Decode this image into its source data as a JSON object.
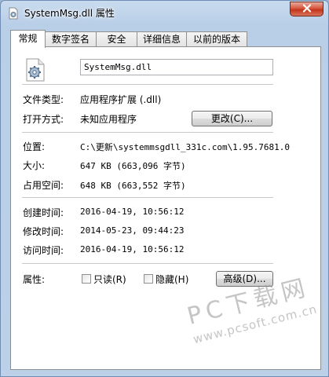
{
  "window": {
    "title": "SystemMsg.dll 属性"
  },
  "tabs": [
    {
      "label": "常规",
      "active": true
    },
    {
      "label": "数字签名",
      "active": false
    },
    {
      "label": "安全",
      "active": false
    },
    {
      "label": "详细信息",
      "active": false
    },
    {
      "label": "以前的版本",
      "active": false
    }
  ],
  "general": {
    "file_name": "SystemMsg.dll",
    "file_type_label": "文件类型:",
    "file_type_value": "应用程序扩展 (.dll)",
    "open_with_label": "打开方式:",
    "open_with_value": "未知应用程序",
    "change_button": "更改(C)...",
    "location_label": "位置:",
    "location_value": "C:\\更新\\systemmsgdll_331c.com\\1.95.7681.0",
    "size_label": "大小:",
    "size_value": "647 KB (663,096 字节)",
    "size_on_disk_label": "占用空间:",
    "size_on_disk_value": "648 KB (663,552 字节)",
    "created_label": "创建时间:",
    "created_value": "2016-04-19, 10:56:12",
    "modified_label": "修改时间:",
    "modified_value": "2014-05-23, 09:44:23",
    "accessed_label": "访问时间:",
    "accessed_value": "2016-04-19, 10:56:12",
    "attributes_label": "属性:",
    "readonly_label": "只读(R)",
    "hidden_label": "隐藏(H)",
    "advanced_button": "高级(D)..."
  },
  "watermark": {
    "main": "PC下载网",
    "sub": "www.pcsoft.com.cn"
  },
  "colors": {
    "close": "#c2351b",
    "panel_border": "#8e8f8f",
    "frame": "#bcd0e8"
  }
}
